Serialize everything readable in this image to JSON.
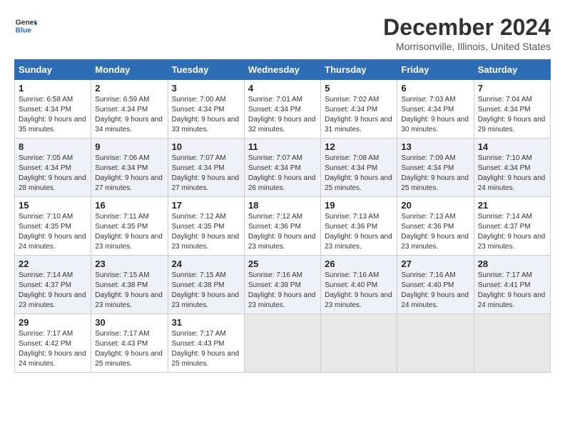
{
  "header": {
    "logo_line1": "General",
    "logo_line2": "Blue",
    "title": "December 2024",
    "subtitle": "Morrisonville, Illinois, United States"
  },
  "weekdays": [
    "Sunday",
    "Monday",
    "Tuesday",
    "Wednesday",
    "Thursday",
    "Friday",
    "Saturday"
  ],
  "weeks": [
    [
      {
        "day": "1",
        "sunrise": "6:58 AM",
        "sunset": "4:34 PM",
        "daylight": "9 hours and 35 minutes."
      },
      {
        "day": "2",
        "sunrise": "6:59 AM",
        "sunset": "4:34 PM",
        "daylight": "9 hours and 34 minutes."
      },
      {
        "day": "3",
        "sunrise": "7:00 AM",
        "sunset": "4:34 PM",
        "daylight": "9 hours and 33 minutes."
      },
      {
        "day": "4",
        "sunrise": "7:01 AM",
        "sunset": "4:34 PM",
        "daylight": "9 hours and 32 minutes."
      },
      {
        "day": "5",
        "sunrise": "7:02 AM",
        "sunset": "4:34 PM",
        "daylight": "9 hours and 31 minutes."
      },
      {
        "day": "6",
        "sunrise": "7:03 AM",
        "sunset": "4:34 PM",
        "daylight": "9 hours and 30 minutes."
      },
      {
        "day": "7",
        "sunrise": "7:04 AM",
        "sunset": "4:34 PM",
        "daylight": "9 hours and 29 minutes."
      }
    ],
    [
      {
        "day": "8",
        "sunrise": "7:05 AM",
        "sunset": "4:34 PM",
        "daylight": "9 hours and 28 minutes."
      },
      {
        "day": "9",
        "sunrise": "7:06 AM",
        "sunset": "4:34 PM",
        "daylight": "9 hours and 27 minutes."
      },
      {
        "day": "10",
        "sunrise": "7:07 AM",
        "sunset": "4:34 PM",
        "daylight": "9 hours and 27 minutes."
      },
      {
        "day": "11",
        "sunrise": "7:07 AM",
        "sunset": "4:34 PM",
        "daylight": "9 hours and 26 minutes."
      },
      {
        "day": "12",
        "sunrise": "7:08 AM",
        "sunset": "4:34 PM",
        "daylight": "9 hours and 25 minutes."
      },
      {
        "day": "13",
        "sunrise": "7:09 AM",
        "sunset": "4:34 PM",
        "daylight": "9 hours and 25 minutes."
      },
      {
        "day": "14",
        "sunrise": "7:10 AM",
        "sunset": "4:34 PM",
        "daylight": "9 hours and 24 minutes."
      }
    ],
    [
      {
        "day": "15",
        "sunrise": "7:10 AM",
        "sunset": "4:35 PM",
        "daylight": "9 hours and 24 minutes."
      },
      {
        "day": "16",
        "sunrise": "7:11 AM",
        "sunset": "4:35 PM",
        "daylight": "9 hours and 23 minutes."
      },
      {
        "day": "17",
        "sunrise": "7:12 AM",
        "sunset": "4:35 PM",
        "daylight": "9 hours and 23 minutes."
      },
      {
        "day": "18",
        "sunrise": "7:12 AM",
        "sunset": "4:36 PM",
        "daylight": "9 hours and 23 minutes."
      },
      {
        "day": "19",
        "sunrise": "7:13 AM",
        "sunset": "4:36 PM",
        "daylight": "9 hours and 23 minutes."
      },
      {
        "day": "20",
        "sunrise": "7:13 AM",
        "sunset": "4:36 PM",
        "daylight": "9 hours and 23 minutes."
      },
      {
        "day": "21",
        "sunrise": "7:14 AM",
        "sunset": "4:37 PM",
        "daylight": "9 hours and 23 minutes."
      }
    ],
    [
      {
        "day": "22",
        "sunrise": "7:14 AM",
        "sunset": "4:37 PM",
        "daylight": "9 hours and 23 minutes."
      },
      {
        "day": "23",
        "sunrise": "7:15 AM",
        "sunset": "4:38 PM",
        "daylight": "9 hours and 23 minutes."
      },
      {
        "day": "24",
        "sunrise": "7:15 AM",
        "sunset": "4:38 PM",
        "daylight": "9 hours and 23 minutes."
      },
      {
        "day": "25",
        "sunrise": "7:16 AM",
        "sunset": "4:39 PM",
        "daylight": "9 hours and 23 minutes."
      },
      {
        "day": "26",
        "sunrise": "7:16 AM",
        "sunset": "4:40 PM",
        "daylight": "9 hours and 23 minutes."
      },
      {
        "day": "27",
        "sunrise": "7:16 AM",
        "sunset": "4:40 PM",
        "daylight": "9 hours and 24 minutes."
      },
      {
        "day": "28",
        "sunrise": "7:17 AM",
        "sunset": "4:41 PM",
        "daylight": "9 hours and 24 minutes."
      }
    ],
    [
      {
        "day": "29",
        "sunrise": "7:17 AM",
        "sunset": "4:42 PM",
        "daylight": "9 hours and 24 minutes."
      },
      {
        "day": "30",
        "sunrise": "7:17 AM",
        "sunset": "4:43 PM",
        "daylight": "9 hours and 25 minutes."
      },
      {
        "day": "31",
        "sunrise": "7:17 AM",
        "sunset": "4:43 PM",
        "daylight": "9 hours and 25 minutes."
      },
      null,
      null,
      null,
      null
    ]
  ]
}
